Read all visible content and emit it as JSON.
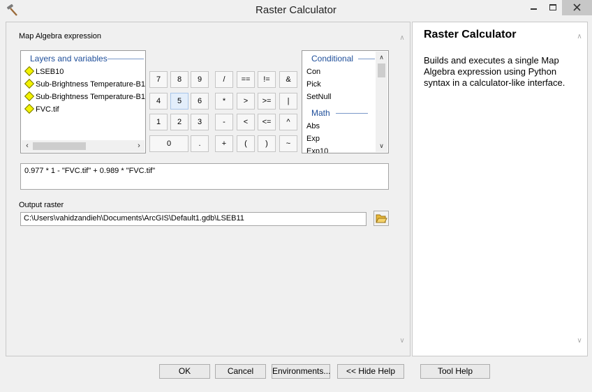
{
  "window": {
    "title": "Raster Calculator"
  },
  "expression_panel": {
    "label": "Map Algebra expression",
    "layers": {
      "heading": "Layers and variables",
      "items": [
        "LSEB10",
        "Sub-Brightness Temperature-B1",
        "Sub-Brightness Temperature-B1",
        "FVC.tif"
      ]
    },
    "keypad": {
      "r1": [
        "7",
        "8",
        "9",
        "/",
        "==",
        "!=",
        "&"
      ],
      "r2": [
        "4",
        "5",
        "6",
        "*",
        ">",
        ">=",
        "|"
      ],
      "r3": [
        "1",
        "2",
        "3",
        "-",
        "<",
        "<=",
        "^"
      ],
      "r4": [
        "0",
        ".",
        "+",
        "(",
        ")",
        "~"
      ]
    },
    "functions": {
      "group1": "Conditional",
      "group1_items": [
        "Con",
        "Pick",
        "SetNull"
      ],
      "group2": "Math",
      "group2_items": [
        "Abs",
        "Exp",
        "Exp10"
      ]
    },
    "expression": "0.977 * 1 - \"FVC.tif\" + 0.989 * \"FVC.tif\"",
    "output_label": "Output raster",
    "output_value": "C:\\Users\\vahidzandieh\\Documents\\ArcGIS\\Default1.gdb\\LSEB11"
  },
  "help": {
    "title": "Raster Calculator",
    "text": "Builds and executes a single Map Algebra expression using Python syntax in a calculator-like interface."
  },
  "buttons": {
    "ok": "OK",
    "cancel": "Cancel",
    "environments": "Environments...",
    "hide_help": "<< Hide Help",
    "tool_help": "Tool Help"
  },
  "icons": {
    "app": "hammer-icon",
    "folder": "open-folder-icon"
  },
  "colors": {
    "group_heading": "#1e4e9a",
    "layer_diamond": "#f2f200",
    "close_button": "#c7c7c7"
  }
}
